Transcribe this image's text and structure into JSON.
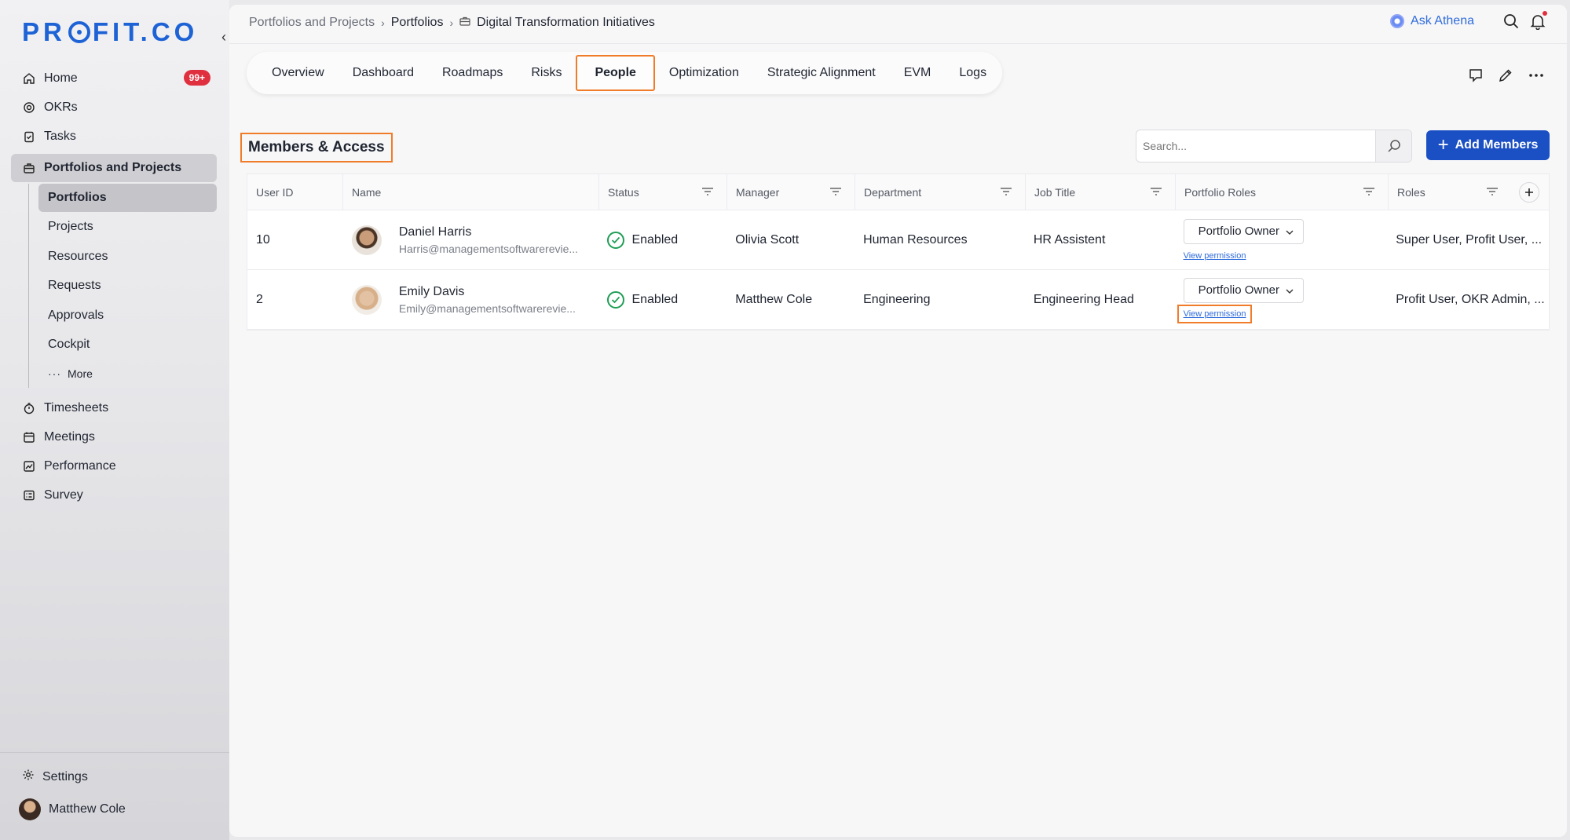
{
  "brand": {
    "logo_text_left": "PR",
    "logo_text_right": "FIT.CO",
    "accent": "#1e63d6"
  },
  "sidebar": {
    "items": [
      {
        "label": "Home",
        "icon": "home-icon",
        "badge": "99+"
      },
      {
        "label": "OKRs",
        "icon": "target-icon"
      },
      {
        "label": "Tasks",
        "icon": "clipboard-icon"
      },
      {
        "label": "Portfolios and Projects",
        "icon": "briefcase-icon"
      }
    ],
    "subitems": [
      "Portfolios",
      "Projects",
      "Resources",
      "Requests",
      "Approvals",
      "Cockpit",
      "More"
    ],
    "items2": [
      {
        "label": "Timesheets",
        "icon": "stopwatch-icon"
      },
      {
        "label": "Meetings",
        "icon": "calendar-icon"
      },
      {
        "label": "Performance",
        "icon": "chart-icon"
      },
      {
        "label": "Survey",
        "icon": "survey-icon"
      }
    ],
    "settings_label": "Settings",
    "user_name": "Matthew Cole"
  },
  "breadcrumb": {
    "level1": "Portfolios and Projects",
    "level2": "Portfolios",
    "current": "Digital Transformation Initiatives"
  },
  "topbar": {
    "ask_label": "Ask Athena"
  },
  "tabs": [
    "Overview",
    "Dashboard",
    "Roadmaps",
    "Risks",
    "People",
    "Optimization",
    "Strategic Alignment",
    "EVM",
    "Logs"
  ],
  "active_tab": "People",
  "section": {
    "title": "Members & Access",
    "search_placeholder": "Search...",
    "add_label": "Add Members"
  },
  "table": {
    "columns": [
      "User ID",
      "Name",
      "Status",
      "Manager",
      "Department",
      "Job Title",
      "Portfolio Roles",
      "Roles"
    ],
    "rows": [
      {
        "user_id": "10",
        "name": "Daniel Harris",
        "email": "Harris@managementsoftwarerevie...",
        "status": "Enabled",
        "manager": "Olivia Scott",
        "department": "Human Resources",
        "job_title": "HR Assistent",
        "portfolio_role": "Portfolio Owner",
        "view_permission": "View permission",
        "roles": "Super User, Profit User, ..."
      },
      {
        "user_id": "2",
        "name": "Emily Davis",
        "email": "Emily@managementsoftwarerevie...",
        "status": "Enabled",
        "manager": "Matthew Cole",
        "department": "Engineering",
        "job_title": "Engineering Head",
        "portfolio_role": "Portfolio Owner",
        "view_permission": "View permission",
        "roles": "Profit User, OKR Admin, ..."
      }
    ]
  },
  "colors": {
    "primary_button": "#1b4fc4",
    "highlight": "#f07c2a",
    "status_green": "#1f9d55",
    "badge_red": "#e0303f"
  }
}
